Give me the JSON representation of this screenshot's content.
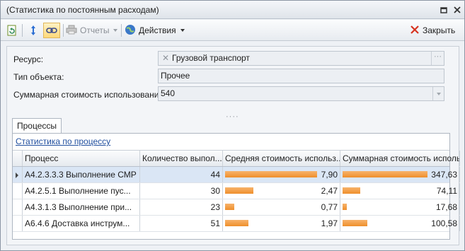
{
  "window": {
    "title": "(Статистика по постоянным расходам)"
  },
  "toolbar": {
    "reports_label": "Отчеты",
    "actions_label": "Действия",
    "close_label": "Закрыть"
  },
  "form": {
    "resource_label": "Ресурс:",
    "resource_value": "Грузовой транспорт",
    "type_label": "Тип объекта:",
    "type_value": "Прочее",
    "total_label": "Суммарная стоимость использования:",
    "total_value": "540"
  },
  "tabs": {
    "processes": "Процессы"
  },
  "panel": {
    "link": "Статистика по процессу"
  },
  "grid": {
    "headers": [
      "Процесс",
      "Количество выпол...",
      "Средняя стоимость использ...",
      "Суммарная стоимость исполь..."
    ],
    "rows": [
      {
        "process": "A4.2.3.3.3 Выполнение СМР",
        "count": "44",
        "avg": "7,90",
        "avg_pct": 100,
        "sum": "347,63",
        "sum_pct": 100,
        "selected": true
      },
      {
        "process": "A4.2.5.1 Выполнение пус...",
        "count": "30",
        "avg": "2,47",
        "avg_pct": 31,
        "sum": "74,11",
        "sum_pct": 21,
        "selected": false
      },
      {
        "process": "A4.3.1.3 Выполнение при...",
        "count": "23",
        "avg": "0,77",
        "avg_pct": 10,
        "sum": "17,68",
        "sum_pct": 5,
        "selected": false
      },
      {
        "process": "A6.4.6 Доставка инструм...",
        "count": "51",
        "avg": "1,97",
        "avg_pct": 25,
        "sum": "100,58",
        "sum_pct": 29,
        "selected": false
      }
    ]
  }
}
